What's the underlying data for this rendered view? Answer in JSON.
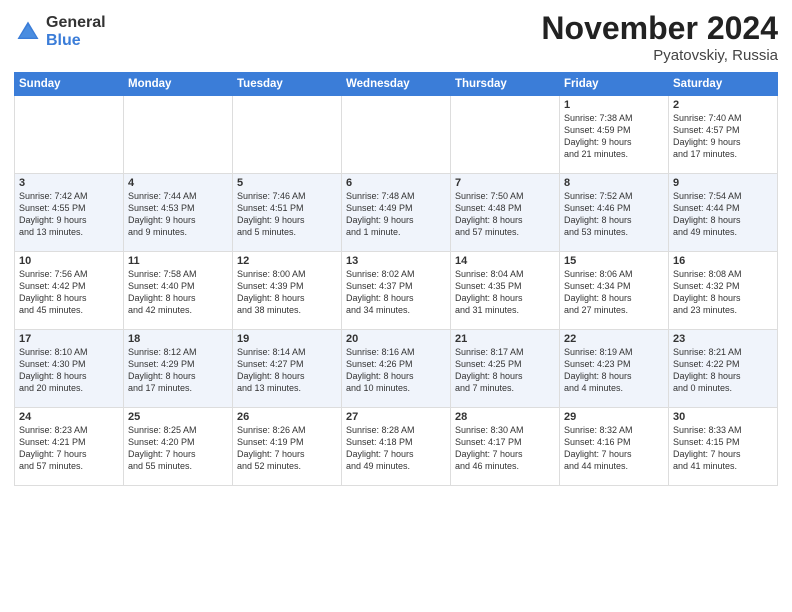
{
  "logo": {
    "general": "General",
    "blue": "Blue"
  },
  "title": "November 2024",
  "location": "Pyatovskiy, Russia",
  "days_header": [
    "Sunday",
    "Monday",
    "Tuesday",
    "Wednesday",
    "Thursday",
    "Friday",
    "Saturday"
  ],
  "weeks": [
    [
      {
        "day": "",
        "info": ""
      },
      {
        "day": "",
        "info": ""
      },
      {
        "day": "",
        "info": ""
      },
      {
        "day": "",
        "info": ""
      },
      {
        "day": "",
        "info": ""
      },
      {
        "day": "1",
        "info": "Sunrise: 7:38 AM\nSunset: 4:59 PM\nDaylight: 9 hours\nand 21 minutes."
      },
      {
        "day": "2",
        "info": "Sunrise: 7:40 AM\nSunset: 4:57 PM\nDaylight: 9 hours\nand 17 minutes."
      }
    ],
    [
      {
        "day": "3",
        "info": "Sunrise: 7:42 AM\nSunset: 4:55 PM\nDaylight: 9 hours\nand 13 minutes."
      },
      {
        "day": "4",
        "info": "Sunrise: 7:44 AM\nSunset: 4:53 PM\nDaylight: 9 hours\nand 9 minutes."
      },
      {
        "day": "5",
        "info": "Sunrise: 7:46 AM\nSunset: 4:51 PM\nDaylight: 9 hours\nand 5 minutes."
      },
      {
        "day": "6",
        "info": "Sunrise: 7:48 AM\nSunset: 4:49 PM\nDaylight: 9 hours\nand 1 minute."
      },
      {
        "day": "7",
        "info": "Sunrise: 7:50 AM\nSunset: 4:48 PM\nDaylight: 8 hours\nand 57 minutes."
      },
      {
        "day": "8",
        "info": "Sunrise: 7:52 AM\nSunset: 4:46 PM\nDaylight: 8 hours\nand 53 minutes."
      },
      {
        "day": "9",
        "info": "Sunrise: 7:54 AM\nSunset: 4:44 PM\nDaylight: 8 hours\nand 49 minutes."
      }
    ],
    [
      {
        "day": "10",
        "info": "Sunrise: 7:56 AM\nSunset: 4:42 PM\nDaylight: 8 hours\nand 45 minutes."
      },
      {
        "day": "11",
        "info": "Sunrise: 7:58 AM\nSunset: 4:40 PM\nDaylight: 8 hours\nand 42 minutes."
      },
      {
        "day": "12",
        "info": "Sunrise: 8:00 AM\nSunset: 4:39 PM\nDaylight: 8 hours\nand 38 minutes."
      },
      {
        "day": "13",
        "info": "Sunrise: 8:02 AM\nSunset: 4:37 PM\nDaylight: 8 hours\nand 34 minutes."
      },
      {
        "day": "14",
        "info": "Sunrise: 8:04 AM\nSunset: 4:35 PM\nDaylight: 8 hours\nand 31 minutes."
      },
      {
        "day": "15",
        "info": "Sunrise: 8:06 AM\nSunset: 4:34 PM\nDaylight: 8 hours\nand 27 minutes."
      },
      {
        "day": "16",
        "info": "Sunrise: 8:08 AM\nSunset: 4:32 PM\nDaylight: 8 hours\nand 23 minutes."
      }
    ],
    [
      {
        "day": "17",
        "info": "Sunrise: 8:10 AM\nSunset: 4:30 PM\nDaylight: 8 hours\nand 20 minutes."
      },
      {
        "day": "18",
        "info": "Sunrise: 8:12 AM\nSunset: 4:29 PM\nDaylight: 8 hours\nand 17 minutes."
      },
      {
        "day": "19",
        "info": "Sunrise: 8:14 AM\nSunset: 4:27 PM\nDaylight: 8 hours\nand 13 minutes."
      },
      {
        "day": "20",
        "info": "Sunrise: 8:16 AM\nSunset: 4:26 PM\nDaylight: 8 hours\nand 10 minutes."
      },
      {
        "day": "21",
        "info": "Sunrise: 8:17 AM\nSunset: 4:25 PM\nDaylight: 8 hours\nand 7 minutes."
      },
      {
        "day": "22",
        "info": "Sunrise: 8:19 AM\nSunset: 4:23 PM\nDaylight: 8 hours\nand 4 minutes."
      },
      {
        "day": "23",
        "info": "Sunrise: 8:21 AM\nSunset: 4:22 PM\nDaylight: 8 hours\nand 0 minutes."
      }
    ],
    [
      {
        "day": "24",
        "info": "Sunrise: 8:23 AM\nSunset: 4:21 PM\nDaylight: 7 hours\nand 57 minutes."
      },
      {
        "day": "25",
        "info": "Sunrise: 8:25 AM\nSunset: 4:20 PM\nDaylight: 7 hours\nand 55 minutes."
      },
      {
        "day": "26",
        "info": "Sunrise: 8:26 AM\nSunset: 4:19 PM\nDaylight: 7 hours\nand 52 minutes."
      },
      {
        "day": "27",
        "info": "Sunrise: 8:28 AM\nSunset: 4:18 PM\nDaylight: 7 hours\nand 49 minutes."
      },
      {
        "day": "28",
        "info": "Sunrise: 8:30 AM\nSunset: 4:17 PM\nDaylight: 7 hours\nand 46 minutes."
      },
      {
        "day": "29",
        "info": "Sunrise: 8:32 AM\nSunset: 4:16 PM\nDaylight: 7 hours\nand 44 minutes."
      },
      {
        "day": "30",
        "info": "Sunrise: 8:33 AM\nSunset: 4:15 PM\nDaylight: 7 hours\nand 41 minutes."
      }
    ]
  ]
}
